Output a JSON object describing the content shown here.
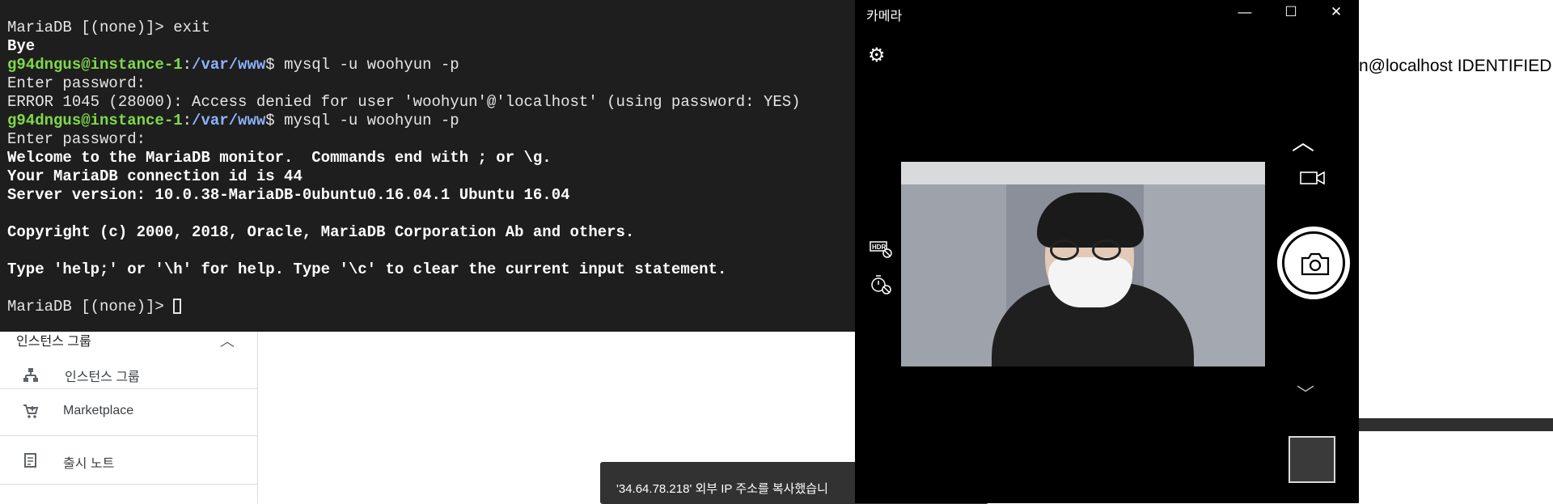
{
  "terminal": {
    "lines": [
      {
        "kind": "plain",
        "text": "MariaDB [(none)]> exit"
      },
      {
        "kind": "bold",
        "text": "Bye"
      },
      {
        "kind": "prompt",
        "user": "g94dngus@instance-1",
        "path": "/var/www",
        "cmd": "$ mysql -u woohyun -p"
      },
      {
        "kind": "plain",
        "text": "Enter password:"
      },
      {
        "kind": "plain",
        "text": "ERROR 1045 (28000): Access denied for user 'woohyun'@'localhost' (using password: YES)"
      },
      {
        "kind": "prompt",
        "user": "g94dngus@instance-1",
        "path": "/var/www",
        "cmd": "$ mysql -u woohyun -p"
      },
      {
        "kind": "plain",
        "text": "Enter password:"
      },
      {
        "kind": "bold",
        "text": "Welcome to the MariaDB monitor.  Commands end with ; or \\g."
      },
      {
        "kind": "bold",
        "text": "Your MariaDB connection id is 44"
      },
      {
        "kind": "bold",
        "text": "Server version: 10.0.38-MariaDB-0ubuntu0.16.04.1 Ubuntu 16.04"
      },
      {
        "kind": "blank",
        "text": ""
      },
      {
        "kind": "bold",
        "text": "Copyright (c) 2000, 2018, Oracle, MariaDB Corporation Ab and others."
      },
      {
        "kind": "blank",
        "text": ""
      },
      {
        "kind": "bold",
        "text": "Type 'help;' or '\\h' for help. Type '\\c' to clear the current input statement."
      },
      {
        "kind": "blank",
        "text": ""
      }
    ],
    "final_prompt": "MariaDB [(none)]> "
  },
  "console": {
    "group_label": "인스턴스 그룹",
    "items": [
      {
        "label": "인스턴스 그룹",
        "icon": "instance-group-icon"
      },
      {
        "label": "Marketplace",
        "icon": "cart-icon"
      },
      {
        "label": "출시 노트",
        "icon": "release-notes-icon"
      }
    ],
    "snippet": "n@localhost IDENTIFIED",
    "toast": "'34.64.78.218' 외부 IP 주소를 복사했습니"
  },
  "camera": {
    "title": "카메라",
    "icons": [
      "settings-icon",
      "hdr-off-icon",
      "timer-off-icon",
      "photo-mode-icon",
      "video-mode-icon",
      "camera-shutter-icon",
      "chevron-down-icon"
    ]
  }
}
